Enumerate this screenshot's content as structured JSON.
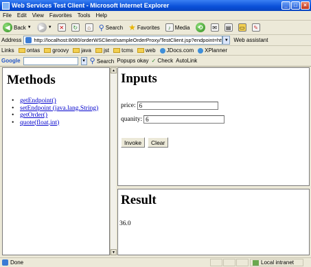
{
  "window": {
    "title": "Web Services Test Client - Microsoft Internet Explorer"
  },
  "menu": [
    "File",
    "Edit",
    "View",
    "Favorites",
    "Tools",
    "Help"
  ],
  "toolbar": {
    "back": "Back",
    "search": "Search",
    "favorites": "Favorites",
    "media": "Media"
  },
  "address": {
    "label": "Address",
    "url": "http://localhost:8080/orderWSClient/sampleOrderProxy/TestClient.jsp?endpoint=http://l",
    "assistant": "Web assistant"
  },
  "links": {
    "label": "Links",
    "items": [
      "ontas",
      "groovy",
      "java",
      "jst",
      "tcms",
      "web",
      "JDocs.com",
      "XPlanner"
    ]
  },
  "google": {
    "logo": "Google",
    "search": "Search",
    "popups": "Popups okay",
    "check": "Check",
    "autolink": "AutoLink"
  },
  "methods": {
    "title": "Methods",
    "items": [
      "getEndpoint()",
      "setEndpoint (java.lang.String)",
      "getOrder()",
      "quote(float,int)"
    ]
  },
  "inputs": {
    "title": "Inputs",
    "price_label": "price:",
    "price_value": "6",
    "quantity_label": "quanity:",
    "quantity_value": "6",
    "invoke": "Invoke",
    "clear": "Clear"
  },
  "result": {
    "title": "Result",
    "value": "36.0"
  },
  "status": {
    "text": "Done",
    "zone": "Local intranet"
  }
}
